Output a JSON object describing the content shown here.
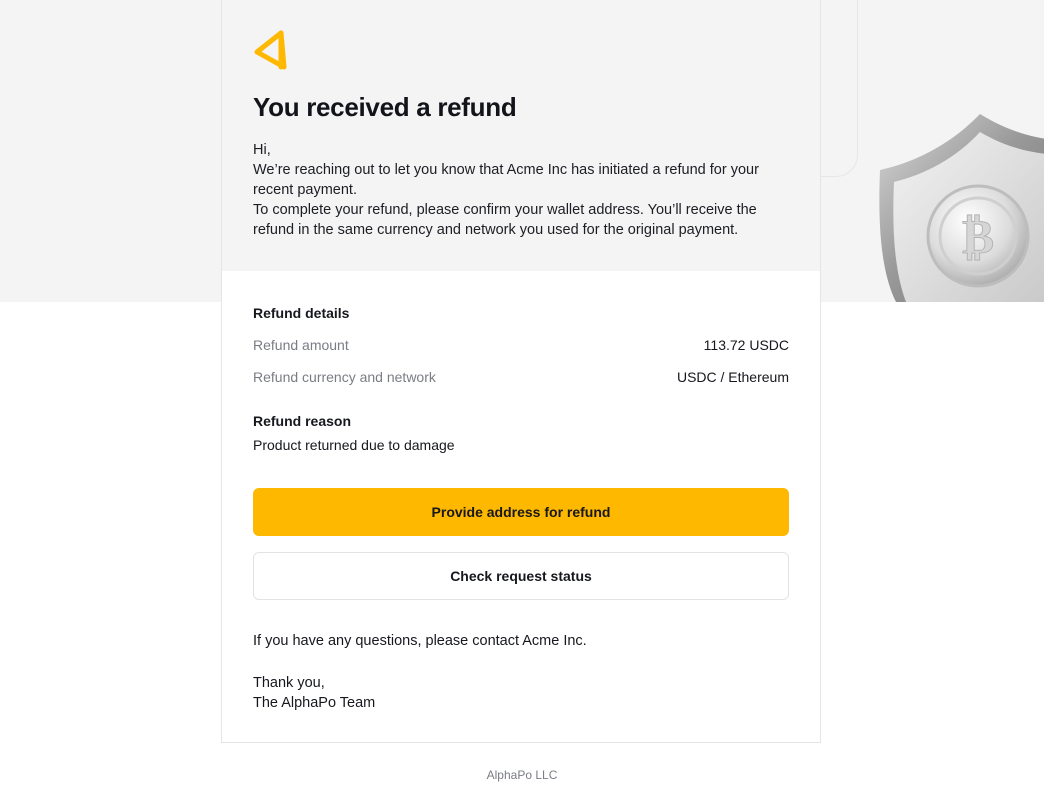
{
  "email": {
    "title": "You received a refund",
    "intro": {
      "greeting": "Hi,",
      "line1": "We’re reaching out to let you know that Acme Inc has initiated a refund for your recent payment.",
      "line2": "To complete your refund, please confirm your wallet address. You’ll receive the refund in the same currency and network you used for the original payment."
    },
    "details": {
      "heading": "Refund details",
      "rows": [
        {
          "label": "Refund amount",
          "value": "113.72 USDC"
        },
        {
          "label": "Refund currency and network",
          "value": "USDC / Ethereum"
        }
      ]
    },
    "reason": {
      "heading": "Refund reason",
      "text": "Product returned due to damage"
    },
    "buttons": {
      "primary_label": "Provide address for refund",
      "secondary_label": "Check request status"
    },
    "contact_text": "If you have any questions, please contact Acme Inc.",
    "signoff": {
      "line1": "Thank you,",
      "line2": "The AlphaPo Team"
    }
  },
  "footer": {
    "company": "AlphaPo LLC"
  },
  "colors": {
    "accent": "#ffb800",
    "header_bg": "#f4f4f4",
    "muted_text": "#7a7d84"
  },
  "icons": {
    "logo": "alphapo-logo-icon",
    "illustration": "bitcoin-shield-icon"
  }
}
